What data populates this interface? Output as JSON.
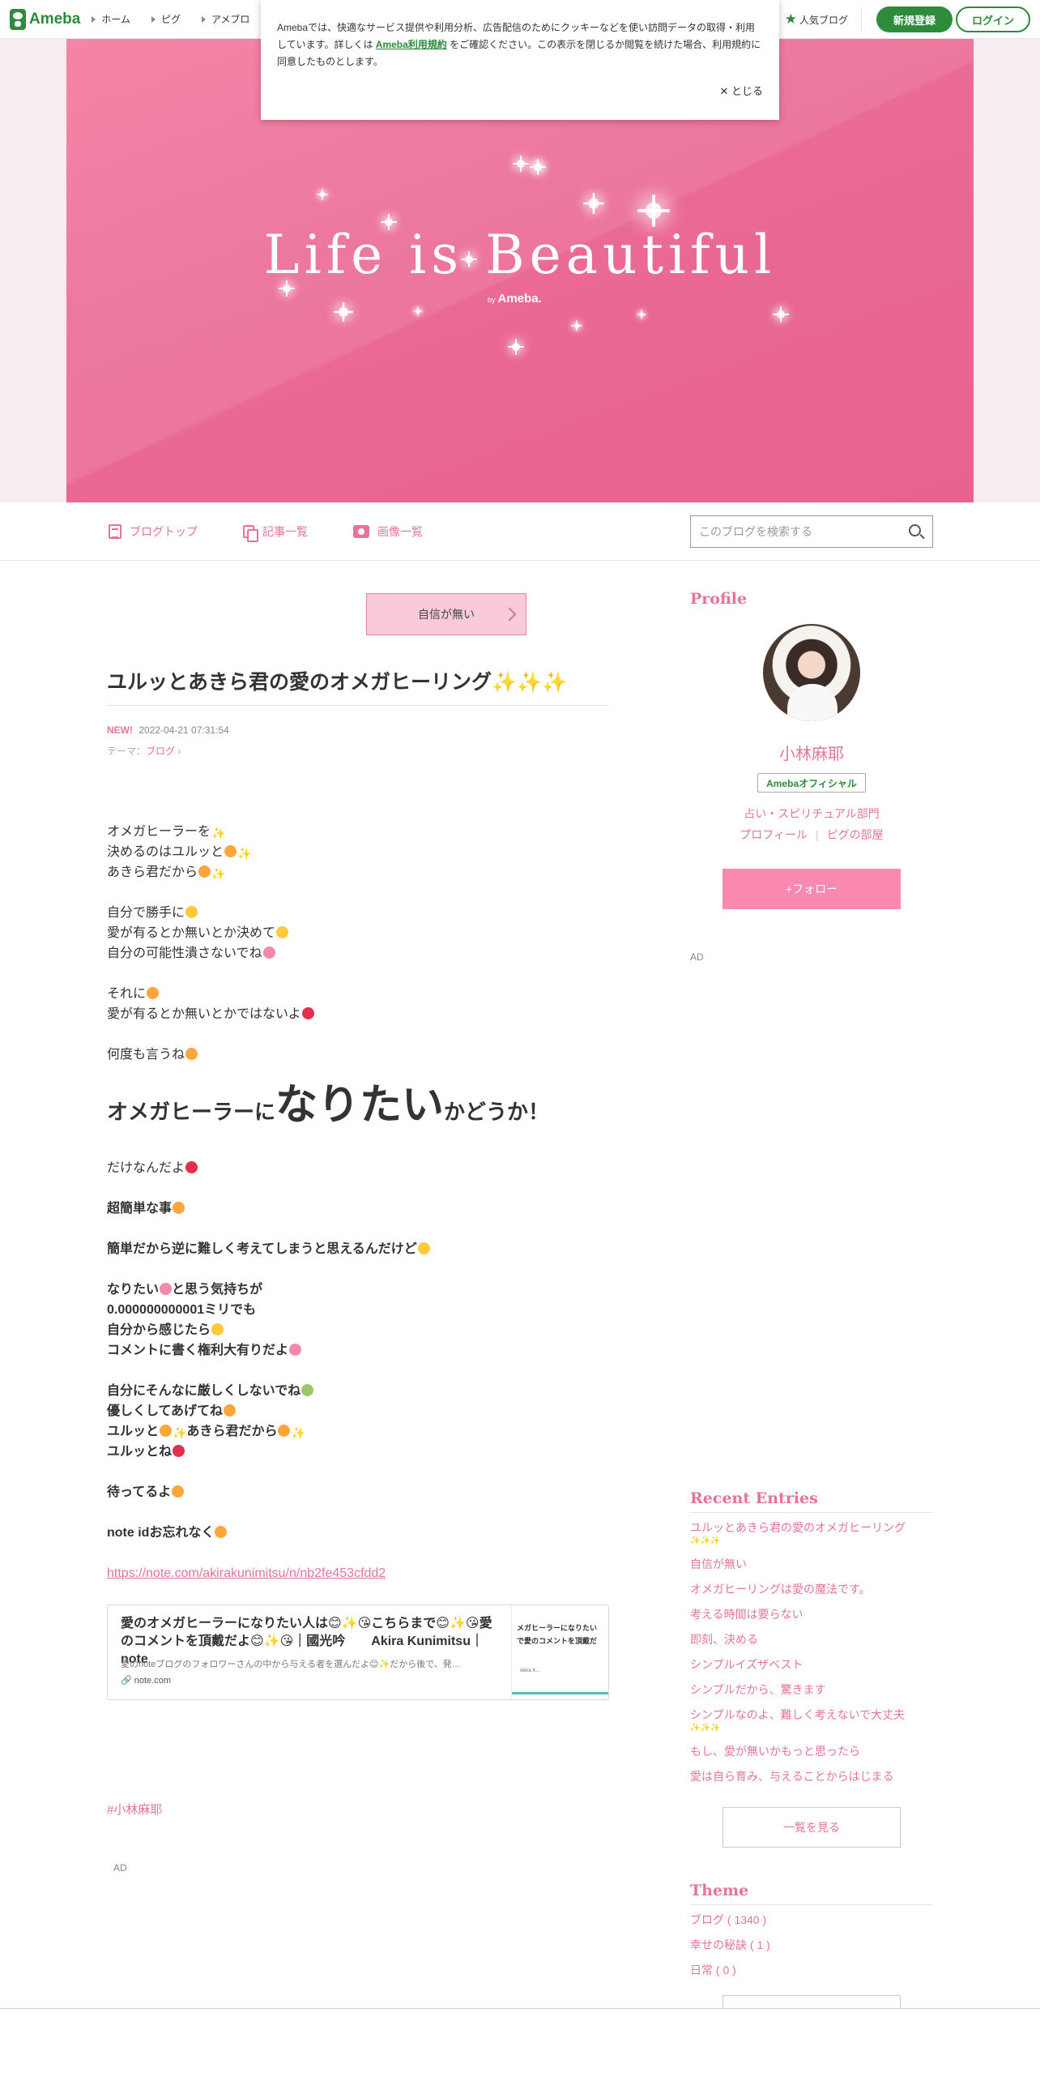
{
  "topnav": {
    "logo": "Ameba",
    "links": [
      "ホーム",
      "ピグ",
      "アメブロ"
    ],
    "popular": "人気ブログ",
    "register": "新規登録",
    "login": "ログイン"
  },
  "cookie": {
    "text1": "Amebaでは、快適なサービス提供や利用分析、広告配信のためにクッキーなどを使い訪問データの取得・利用しています。詳しくは",
    "link": "Ameba利用規約",
    "text2": "をご確認ください。この表示を閉じるか閲覧を続けた場合、利用規約に同意したものとします。",
    "close": "✕ とじる"
  },
  "hero": {
    "title": "Life is Beautiful",
    "by_small": "by",
    "by": "Ameba."
  },
  "blognav": {
    "top": "ブログトップ",
    "entries": "記事一覧",
    "images": "画像一覧",
    "search_placeholder": "このブログを検索する"
  },
  "entry": {
    "tag_button": "自信が無い",
    "title": "ユルッとあきら君の愛のオメガヒーリング✨✨✨",
    "new_badge": "NEW!",
    "datetime": "2022-04-21 07:31:54",
    "theme_label": "テーマ：",
    "theme_value": "ブログ",
    "lines_a": [
      "オメガヒーラーを",
      "決めるのはユルッと",
      "あきら君だから"
    ],
    "lines_b": [
      "自分で勝手に",
      "愛が有るとか無いとか決めて",
      "自分の可能性潰さないでね"
    ],
    "lines_c": [
      "それに",
      "愛が有るとか無いとかではないよ"
    ],
    "line_d": "何度も言うね",
    "heading_pre": "オメガヒーラーに",
    "heading_big": "なりたい",
    "heading_post": "かどうか！",
    "line_e": "だけなんだよ",
    "bold_1": "超簡単な事",
    "bold_2": "簡単だから逆に難しく考えてしまうと思えるんだけど",
    "bold_3": [
      "なりたい",
      "と思う気持ちが",
      "0.000000000001ミリでも",
      "自分から感じたら",
      "コメントに書く権利大有りだよ"
    ],
    "bold_4": [
      "自分にそんなに厳しくしないでね",
      "優しくしてあげてね",
      "ユルッと",
      "あきら君だから",
      "ユルッとね"
    ],
    "bold_5": "待ってるよ",
    "bold_6": "note idお忘れなく",
    "url": "https://note.com/akirakunimitsu/n/nb2fe453cfdd2",
    "card": {
      "title": "愛のオメガヒーラーになりたい人は😊✨😘こちらまで😊✨😘愛のコメントを頂戴だよ😊✨😘｜國光吟　　Akira Kunimitsu｜note",
      "desc": "愛のnoteブログのフォロワーさんの中から与える者を選んだよ😊✨だから後で、発…",
      "domain": "note.com",
      "thumb_text": "メガヒーラーになりたい\nで愛のコメントを頂戴だ",
      "thumb_author": "Akira K..."
    },
    "hashtag": "#小林麻耶",
    "ad": "AD"
  },
  "sidebar": {
    "profile_heading": "Profile",
    "name": "小林麻耶",
    "official": "Amebaオフィシャル",
    "category": "占い・スピリチュアル部門",
    "link_profile": "プロフィール",
    "link_pig": "ピグの部屋",
    "follow": "+フォロー",
    "ad": "AD",
    "recent_heading": "Recent Entries",
    "recent": [
      {
        "title": "ユルッとあきら君の愛のオメガヒーリング",
        "sub": "✨✨✨"
      },
      {
        "title": "自信が無い",
        "sub": ""
      },
      {
        "title": "オメガヒーリングは愛の魔法です。",
        "sub": ""
      },
      {
        "title": "考える時間は要らない",
        "sub": ""
      },
      {
        "title": "即刻、決める",
        "sub": ""
      },
      {
        "title": "シンプルイズザベスト",
        "sub": ""
      },
      {
        "title": "シンプルだから、驚きます",
        "sub": ""
      },
      {
        "title": "シンプルなのよ、難しく考えないで大丈夫",
        "sub": "✨✨✨"
      },
      {
        "title": "もし、愛が無いかもっと思ったら",
        "sub": ""
      },
      {
        "title": "愛は自ら育み、与えることからはじまる",
        "sub": ""
      }
    ],
    "more": "一覧を見る",
    "theme_heading": "Theme",
    "themes": [
      "ブログ ( 1340 )",
      "幸せの秘訣 ( 1 )",
      "日常 ( 0 )"
    ]
  }
}
